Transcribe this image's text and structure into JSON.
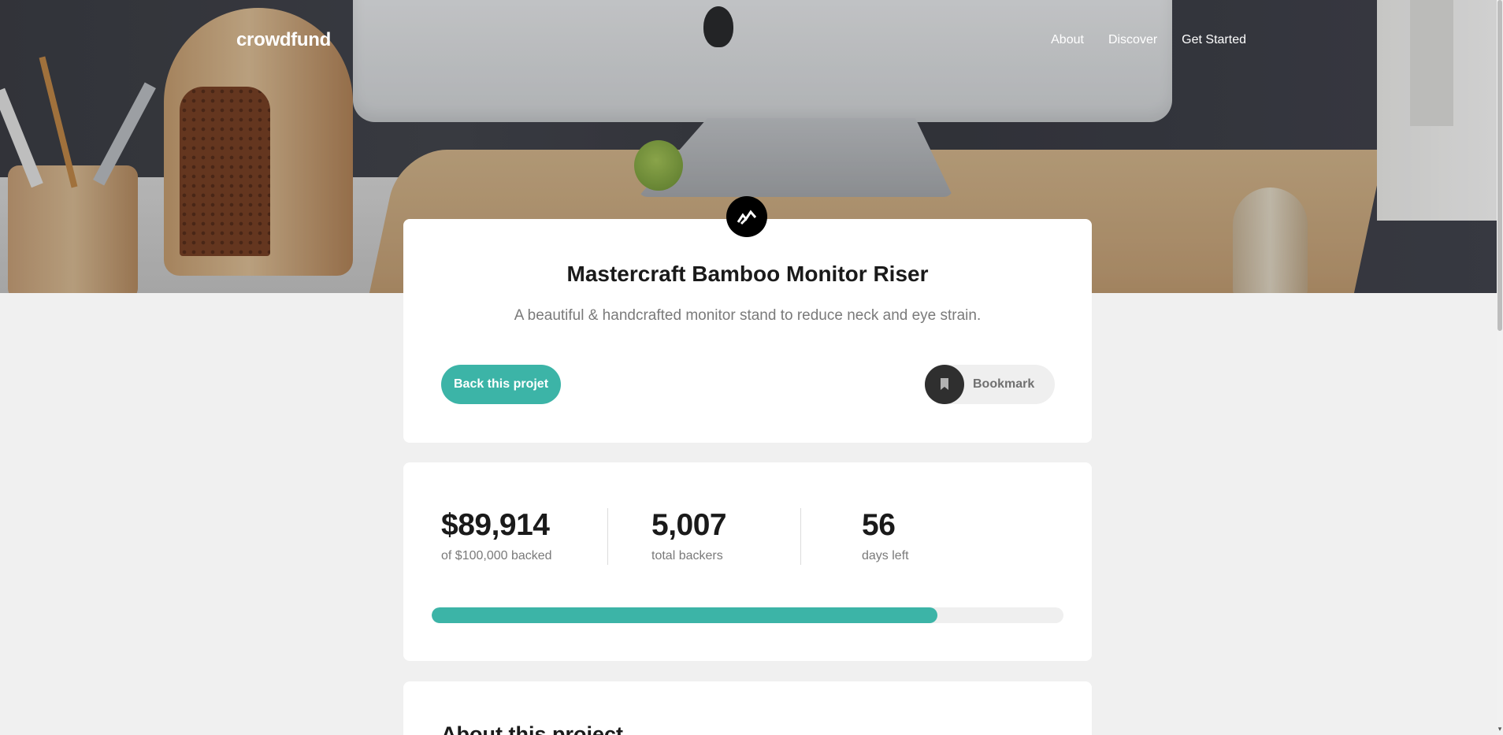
{
  "header": {
    "logo": "crowdfund",
    "nav": [
      {
        "label": "About"
      },
      {
        "label": "Discover"
      },
      {
        "label": "Get Started"
      }
    ]
  },
  "project": {
    "logo_icon": "mastercraft-logo-icon",
    "title": "Mastercraft Bamboo Monitor Riser",
    "subtitle": "A beautiful & handcrafted monitor stand to reduce neck and eye strain.",
    "back_label": "Back this projet",
    "bookmark_label": "Bookmark",
    "bookmark_icon": "bookmark-icon"
  },
  "stats": {
    "backed_amount": "$89,914",
    "backed_label": "of $100,000 backed",
    "backers": "5,007",
    "backers_label": "total backers",
    "days": "56",
    "days_label": "days left",
    "progress_fraction": 0.8
  },
  "about": {
    "title": "About this project"
  },
  "colors": {
    "accent": "#3cb4a7",
    "dark": "#2f2f2f",
    "background": "#f0f0f0"
  }
}
